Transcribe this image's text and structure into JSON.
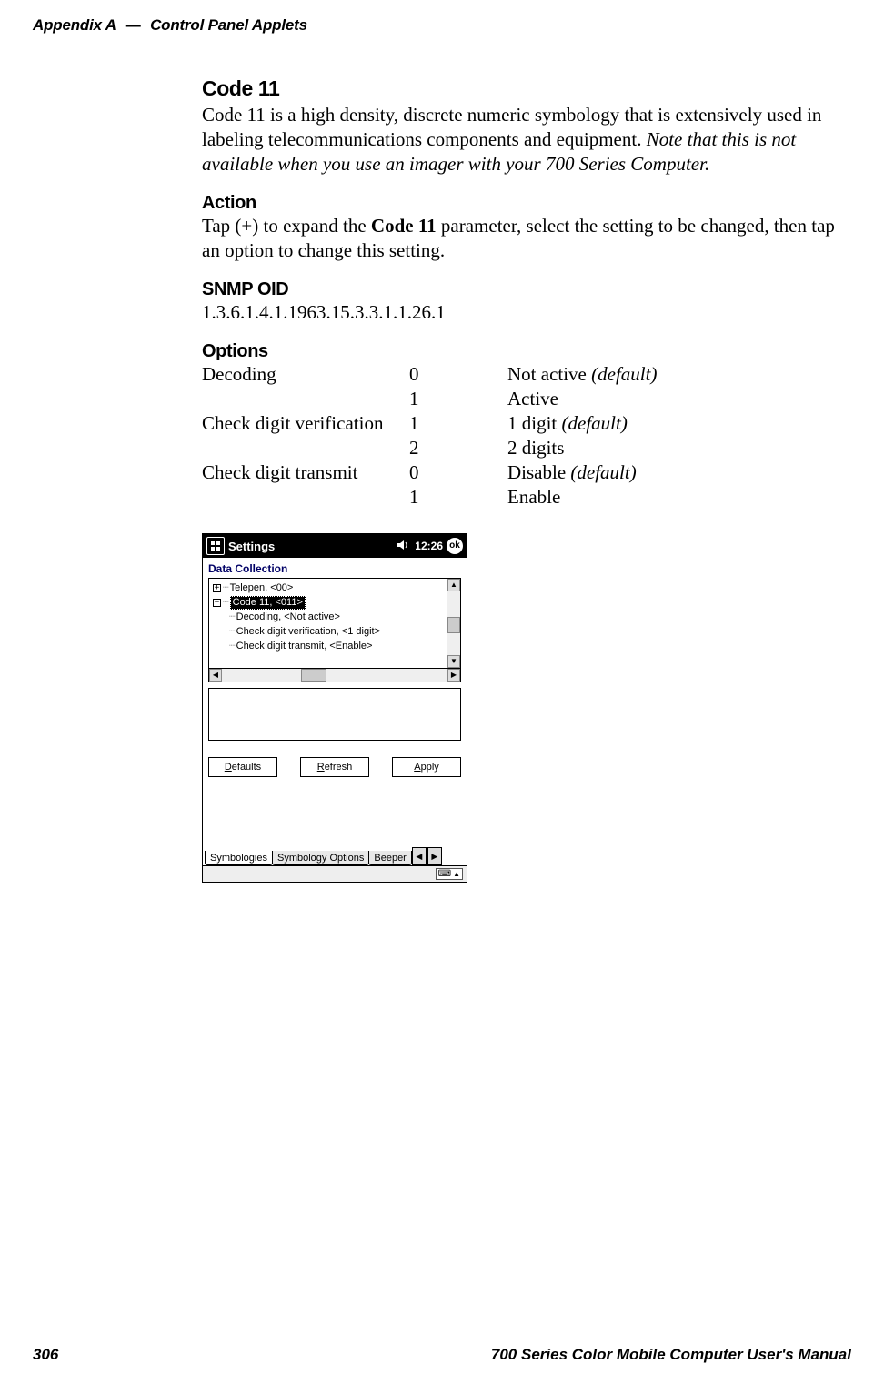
{
  "header": {
    "appendix": "Appendix",
    "letter": "A",
    "dash": "—",
    "section": "Control Panel Applets"
  },
  "footer": {
    "page": "306",
    "book": "700 Series Color Mobile Computer User's Manual"
  },
  "code11": {
    "heading": "Code 11",
    "para_plain": "Code 11 is a high density, discrete numeric symbology that is extensively used in labeling telecommunications components and equipment. ",
    "para_italic": "Note that this is not available when you use an imager with your 700 Series Computer."
  },
  "action": {
    "heading": "Action",
    "pre": "Tap (+) to expand the ",
    "bold": "Code 11",
    "post": " parameter, select the setting to be changed, then tap an option to change this setting."
  },
  "snmp": {
    "heading": "SNMP OID",
    "value": "1.3.6.1.4.1.1963.15.3.3.1.1.26.1"
  },
  "options": {
    "heading": "Options",
    "rows": [
      {
        "param": "Decoding",
        "code": "0",
        "desc": "Not active ",
        "default": "(default)"
      },
      {
        "param": "",
        "code": "1",
        "desc": "Active",
        "default": ""
      },
      {
        "param": "Check digit verification",
        "code": "1",
        "desc": "1 digit ",
        "default": "(default)"
      },
      {
        "param": "",
        "code": "2",
        "desc": "2 digits",
        "default": ""
      },
      {
        "param": "Check digit transmit",
        "code": "0",
        "desc": "Disable ",
        "default": "(default)"
      },
      {
        "param": "",
        "code": "1",
        "desc": "Enable",
        "default": ""
      }
    ]
  },
  "device": {
    "titlebar": {
      "app": "Settings",
      "clock": "12:26",
      "ok": "ok"
    },
    "applet_title": "Data Collection",
    "tree": {
      "node0": "Telepen, <00>",
      "node1": "Code 11, <011>",
      "node1a": "Decoding, <Not active>",
      "node1b": "Check digit verification, <1 digit>",
      "node1c": "Check digit transmit, <Enable>"
    },
    "buttons": {
      "defaults_pre": "D",
      "defaults_rest": "efaults",
      "refresh_pre": "R",
      "refresh_rest": "efresh",
      "apply_pre": "A",
      "apply_rest": "pply"
    },
    "tabs": {
      "t1": "Symbologies",
      "t2": "Symbology Options",
      "t3": "Beeper"
    }
  }
}
